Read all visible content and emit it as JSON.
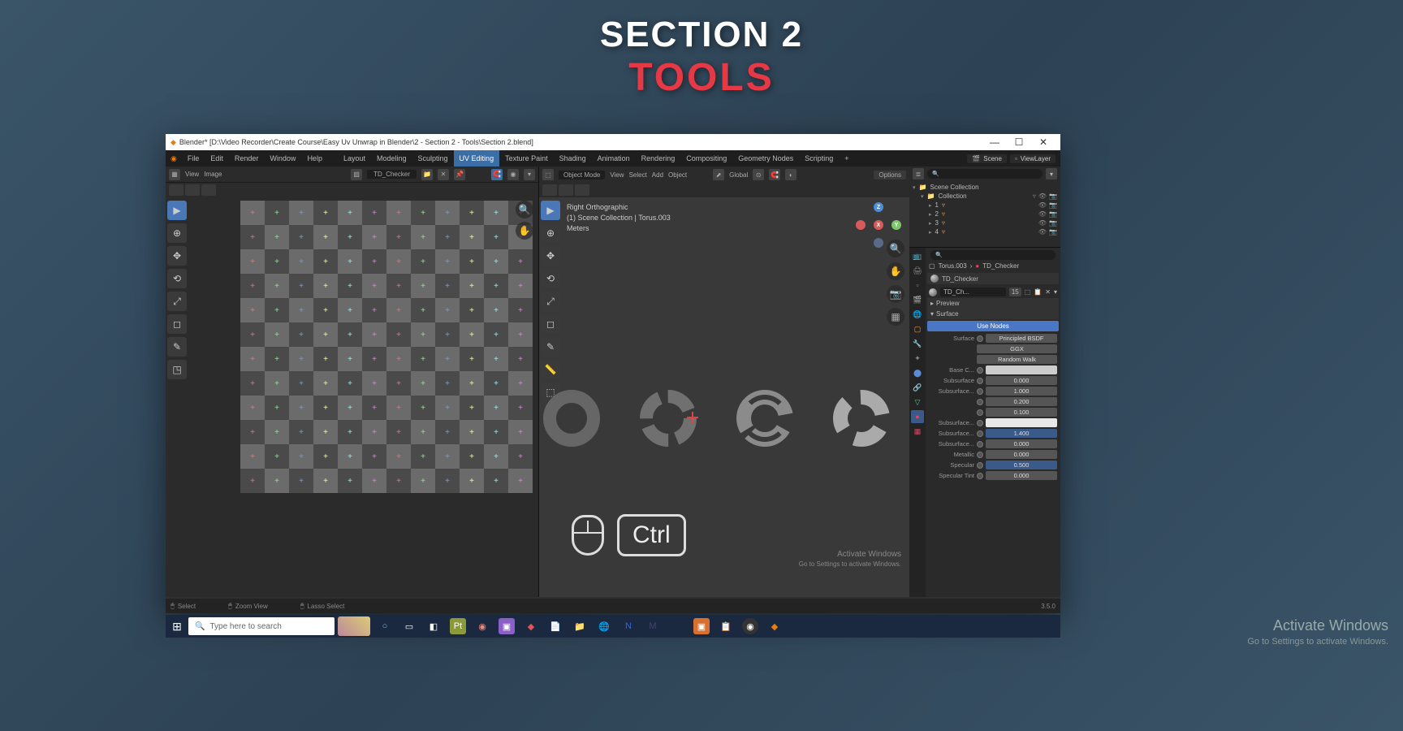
{
  "title": {
    "line1": "SECTION 2",
    "line2": "TOOLS"
  },
  "window": {
    "title": "Blender* [D:\\Video Recorder\\Create Course\\Easy Uv Unwrap in Blender\\2 - Section 2 - Tools\\Section 2.blend]",
    "min": "—",
    "max": "☐",
    "close": "✕"
  },
  "menu": {
    "items": [
      "File",
      "Edit",
      "Render",
      "Window",
      "Help"
    ],
    "workspaces": [
      "Layout",
      "Modeling",
      "Sculpting",
      "UV Editing",
      "Texture Paint",
      "Shading",
      "Animation",
      "Rendering",
      "Compositing",
      "Geometry Nodes",
      "Scripting"
    ],
    "active_ws": "UV Editing",
    "scene_label": "Scene",
    "layer_label": "ViewLayer"
  },
  "uv": {
    "header": {
      "view": "View",
      "image": "Image",
      "texture_name": "TD_Checker"
    }
  },
  "viewport": {
    "mode": "Object Mode",
    "header_items": [
      "View",
      "Select",
      "Add",
      "Object"
    ],
    "orientation": "Global",
    "options": "Options",
    "info": {
      "line1": "Right Orthographic",
      "line2": "(1) Scene Collection | Torus.003",
      "line3": "Meters"
    },
    "key_overlay": "Ctrl"
  },
  "outliner": {
    "root": "Scene Collection",
    "collection": "Collection",
    "items": [
      "1",
      "2",
      "3",
      "4"
    ]
  },
  "props": {
    "breadcrumb_obj": "Torus.003",
    "breadcrumb_mat": "TD_Checker",
    "material_name": "TD_Checker",
    "mat_short": "TD_Ch...",
    "slot_count": "15",
    "preview": "Preview",
    "surface_hdr": "Surface",
    "use_nodes": "Use Nodes",
    "surface_lbl": "Surface",
    "surface_val": "Principled BSDF",
    "distribution": "GGX",
    "subsurf_method": "Random Walk",
    "rows": [
      {
        "lbl": "Base C...",
        "type": "color",
        "color": "#cccccc"
      },
      {
        "lbl": "Subsurface",
        "val": "0.000"
      },
      {
        "lbl": "Subsurface...",
        "val": "1.000"
      },
      {
        "lbl": "",
        "val": "0.200"
      },
      {
        "lbl": "",
        "val": "0.100"
      },
      {
        "lbl": "Subsurface...",
        "type": "color",
        "color": "#e8e8e8"
      },
      {
        "lbl": "Subsurface...",
        "val": "1.400",
        "blue": true
      },
      {
        "lbl": "Subsurface...",
        "val": "0.000"
      },
      {
        "lbl": "Metallic",
        "val": "0.000"
      },
      {
        "lbl": "Specular",
        "val": "0.500",
        "blue": true
      },
      {
        "lbl": "Specular Tint",
        "val": "0.000"
      }
    ]
  },
  "status": {
    "left": "Select",
    "mid": "Zoom View",
    "right": "Lasso Select",
    "version": "3.5.0"
  },
  "taskbar": {
    "search_placeholder": "Type here to search"
  },
  "activate": {
    "title": "Activate Windows",
    "sub": "Go to Settings to activate Windows."
  }
}
